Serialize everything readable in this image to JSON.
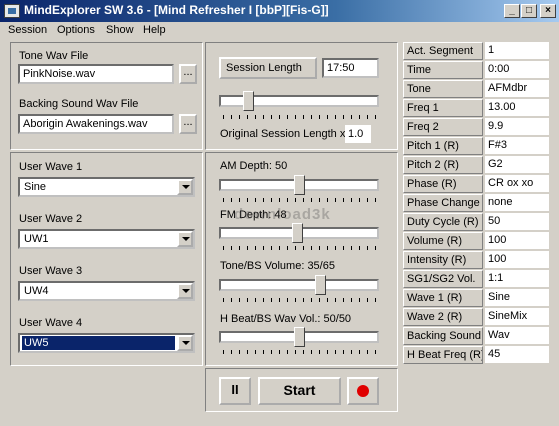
{
  "window": {
    "title": "MindExplorer SW 3.6 - [Mind Refresher I [bbP][Fis-G]]"
  },
  "caption_buttons": {
    "minimize": "_",
    "maximize": "□",
    "close": "×"
  },
  "menu": [
    "Session",
    "Options",
    "Show",
    "Help"
  ],
  "files": {
    "tone_label": "Tone Wav File",
    "tone_value": "PinkNoise.wav",
    "backing_label": "Backing Sound Wav File",
    "backing_value": "Aborigin Awakenings.wav",
    "browse_label": "..."
  },
  "session": {
    "length_label": "Session Length",
    "length_value": "17:50",
    "original_label": "Original Session Length x",
    "original_value": "1.0",
    "slider_level": 0.15
  },
  "waves": [
    {
      "label": "User Wave 1",
      "value": "Sine"
    },
    {
      "label": "User Wave 2",
      "value": "UW1"
    },
    {
      "label": "User Wave 3",
      "value": "UW4"
    },
    {
      "label": "User Wave 4",
      "value": "UW5"
    }
  ],
  "sliders": [
    {
      "label": "AM Depth: 50",
      "level": 0.5
    },
    {
      "label": "FM Depth: 48",
      "level": 0.49
    },
    {
      "label": "Tone/BS Volume: 35/65",
      "level": 0.65
    },
    {
      "label": "H Beat/BS Wav Vol.: 50/50",
      "level": 0.5
    }
  ],
  "controls": {
    "pause": "II",
    "start": "Start"
  },
  "watermark": "download3k",
  "colors": {
    "title_start": "#0a246a",
    "title_end": "#a6caf0",
    "record": "#e00000",
    "selection": "#0a246a"
  },
  "status_table": [
    {
      "key": "Act. Segment",
      "value": "1"
    },
    {
      "key": "Time",
      "value": "0:00"
    },
    {
      "key": "Tone",
      "value": "AFMdbr"
    },
    {
      "key": "Freq 1",
      "value": "13.00"
    },
    {
      "key": "Freq 2",
      "value": "9.9"
    },
    {
      "key": "Pitch 1 (R)",
      "value": "F#3"
    },
    {
      "key": "Pitch 2 (R)",
      "value": "G2"
    },
    {
      "key": "Phase (R)",
      "value": "CR ox xo"
    },
    {
      "key": "Phase Change",
      "value": "none"
    },
    {
      "key": "Duty Cycle (R)",
      "value": "50"
    },
    {
      "key": "Volume (R)",
      "value": "100"
    },
    {
      "key": "Intensity (R)",
      "value": "100"
    },
    {
      "key": "SG1/SG2 Vol.",
      "value": "1:1"
    },
    {
      "key": "Wave 1 (R)",
      "value": "Sine"
    },
    {
      "key": "Wave 2 (R)",
      "value": "SineMix"
    },
    {
      "key": "Backing Sound",
      "value": "Wav"
    },
    {
      "key": "H Beat Freq (R)",
      "value": "45"
    }
  ]
}
